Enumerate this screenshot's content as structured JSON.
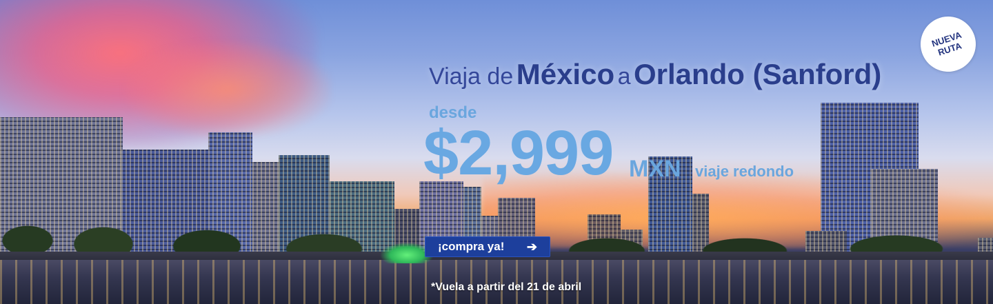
{
  "banner": {
    "headline": {
      "part1": "Viaja de",
      "origin": "México",
      "part2": "a",
      "destination": "Orlando (Sanford)"
    },
    "desde": "desde",
    "price": "$2,999",
    "currency": "MXN",
    "trip_type": "viaje redondo",
    "cta_label": "¡compra ya!",
    "cta_icon": "arrow-right-icon",
    "note": "*Vuela a partir del 21 de abril",
    "badge": {
      "line1": "NUEVA",
      "line2": "RUTA"
    }
  },
  "colors": {
    "headline": "#2a3e8c",
    "price": "#69a8e2",
    "cta_background": "#1d3f9c",
    "badge_text": "#23347f"
  }
}
